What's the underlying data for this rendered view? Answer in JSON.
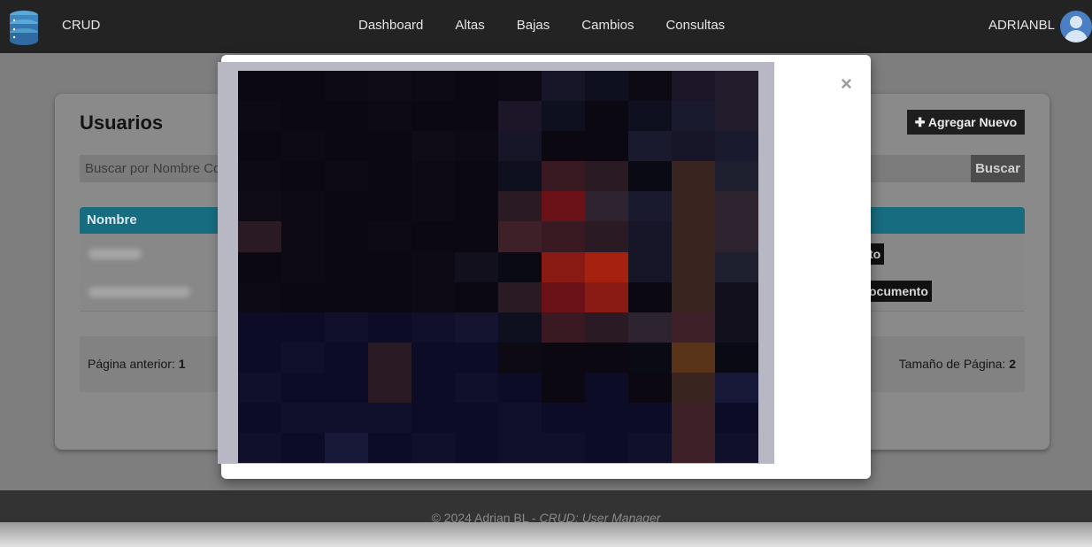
{
  "navbar": {
    "brand": "CRUD",
    "brand_icon": "database-icon",
    "links": [
      "Dashboard",
      "Altas",
      "Bajas",
      "Cambios",
      "Consultas"
    ],
    "user": "ADRIANBL",
    "avatar_icon": "user-avatar-icon"
  },
  "main": {
    "title": "Usuarios",
    "add_button": "Agregar Nuevo",
    "search_placeholder": "Buscar por Nombre Co",
    "search_button": "Buscar",
    "table": {
      "headers": [
        "Nombre"
      ],
      "row_buttons": [
        "to",
        "ocumento"
      ]
    },
    "pager": {
      "prev_label": "Página anterior:",
      "prev_value": "1",
      "size_label": "Tamaño de Página:",
      "size_value": "2"
    }
  },
  "footer": {
    "text": "© 2024 Adrian BL - ",
    "italic": "CRUD: User Manager"
  },
  "modal": {
    "close_label": "×",
    "image_description_icon": "pixelated-photo"
  },
  "colors": {
    "navbar_bg": "#232323",
    "table_header": "#186c80",
    "modal_bg": "#ffffff"
  }
}
